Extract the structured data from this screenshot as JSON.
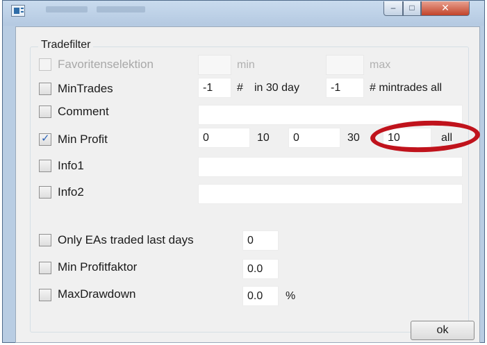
{
  "window": {
    "title": ""
  },
  "titlebar": {
    "minimize": "‒",
    "maximize": "□",
    "close": "✕"
  },
  "group": {
    "title": "Tradefilter"
  },
  "favoritenselektion": {
    "label": "Favoritenselektion",
    "min_label": "min",
    "max_label": "max",
    "min_value": "",
    "max_value": ""
  },
  "mintrades": {
    "label": "MinTrades",
    "value1": "-1",
    "hash": "#",
    "in_days": "in 30 day",
    "value2": "-1",
    "all_label": "# mintrades all"
  },
  "comment": {
    "label": "Comment",
    "value": ""
  },
  "min_profit": {
    "label": "Min Profit",
    "checked": true,
    "v1": "0",
    "t1": "10",
    "v2": "0",
    "t2": "30",
    "v3": "10",
    "t3": "all"
  },
  "info1": {
    "label": "Info1",
    "value": ""
  },
  "info2": {
    "label": "Info2",
    "value": ""
  },
  "only_eas": {
    "label": "Only EAs traded last days",
    "value": "0"
  },
  "min_profitfaktor": {
    "label": "Min Profitfaktor",
    "value": "0.0"
  },
  "max_drawdown": {
    "label": "MaxDrawdown",
    "value": "0.0",
    "unit": "%"
  },
  "ok_button": {
    "label": "ok"
  },
  "colors": {
    "annotation": "#c0131c",
    "checkmark": "#2b62b6",
    "titlebar": "#b9cde3"
  }
}
